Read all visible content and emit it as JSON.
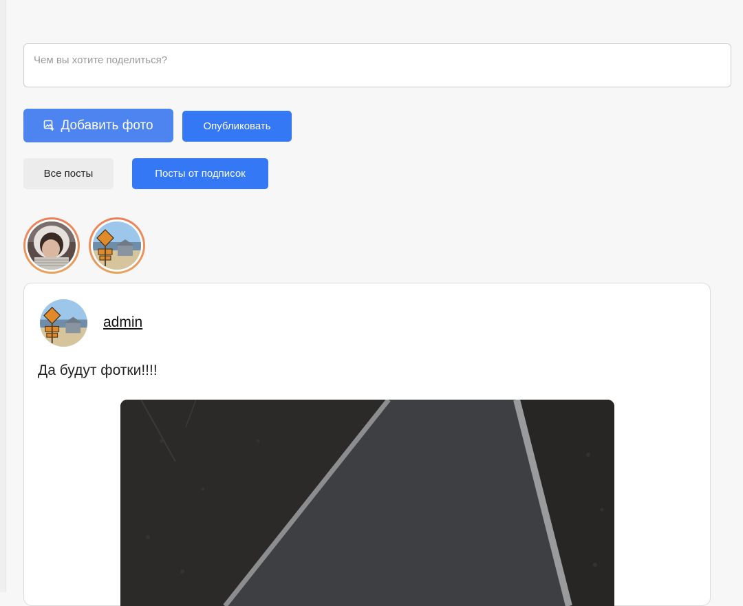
{
  "composer": {
    "placeholder": "Чем вы хотите поделиться?"
  },
  "actions": {
    "add_photo_label": "Добавить фото",
    "add_photo_icon": "add-image-icon",
    "publish_label": "Опубликовать"
  },
  "feed_filter": {
    "all_posts_label": "Все посты",
    "subscriptions_posts_label": "Посты от подписок",
    "active": "subscriptions"
  },
  "stories": [
    {
      "user": "story-user-1"
    },
    {
      "user": "story-user-2"
    }
  ],
  "post": {
    "author": "admin",
    "text": "Да будут фотки!!!!"
  },
  "colors": {
    "primary": "#3478f6",
    "add_photo": "#4d84ef",
    "secondary_button": "#ececec",
    "story_ring": "#f07a5a",
    "page_bg": "#f7f7f7"
  }
}
